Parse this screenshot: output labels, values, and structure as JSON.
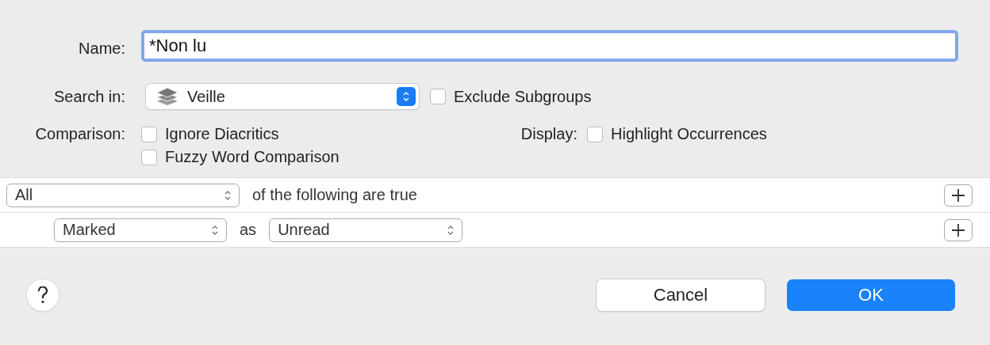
{
  "name_field": {
    "label": "Name:",
    "value": "*Non lu",
    "focused": true
  },
  "search_in": {
    "label": "Search in:",
    "value": "Veille",
    "exclude": {
      "label": "Exclude Subgroups",
      "checked": false
    }
  },
  "comparison": {
    "label": "Comparison:",
    "options": [
      {
        "label": "Ignore Diacritics",
        "checked": false
      },
      {
        "label": "Fuzzy Word Comparison",
        "checked": false
      }
    ]
  },
  "display": {
    "label": "Display:",
    "options": [
      {
        "label": "Highlight Occurrences",
        "checked": false
      }
    ]
  },
  "rules": [
    {
      "kind": "group",
      "popups": [
        "All"
      ],
      "texts": [
        "of the following are true"
      ]
    },
    {
      "kind": "condition",
      "popups": [
        "Marked",
        "Unread"
      ],
      "texts": [
        "as"
      ]
    }
  ],
  "buttons": [
    {
      "label": "Cancel",
      "default": false
    },
    {
      "label": "OK",
      "default": true
    }
  ]
}
